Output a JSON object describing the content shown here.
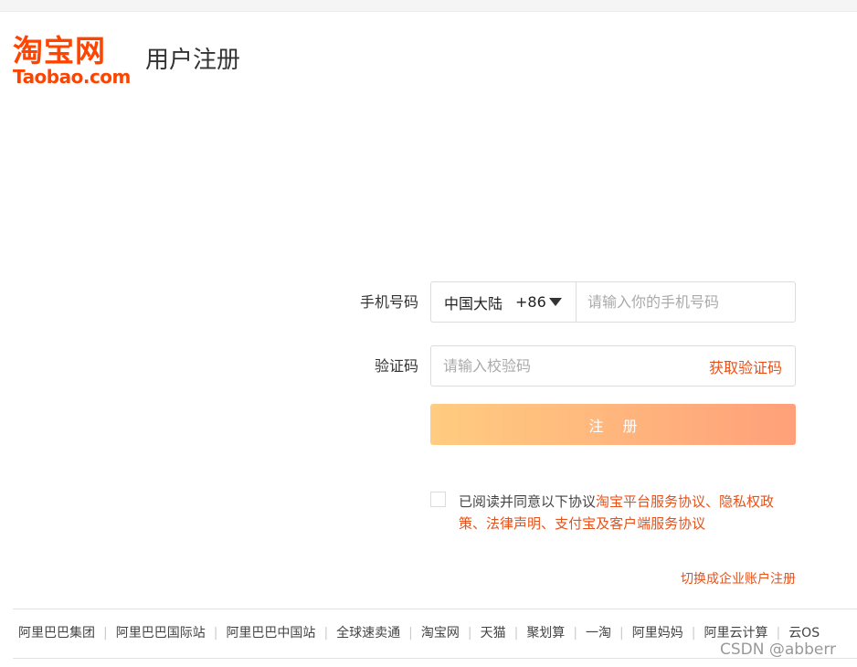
{
  "header": {
    "logo_cn": "淘宝网",
    "logo_en": "Taobao.com",
    "title": "用户注册"
  },
  "form": {
    "phone_label": "手机号码",
    "region_name": "中国大陆",
    "region_code": "+86",
    "phone_placeholder": "请输入你的手机号码",
    "code_label": "验证码",
    "code_placeholder": "请输入校验码",
    "get_code_label": "获取验证码",
    "submit_label": "注 册"
  },
  "agreement": {
    "checked": false,
    "prefix": "已阅读并同意以下协议",
    "links": [
      "淘宝平台服务协议",
      "隐私权政策",
      "法律声明",
      "支付宝及客户端服务协议"
    ],
    "separator": "、"
  },
  "switch_enterprise": "切换成企业账户注册",
  "footer": {
    "links": [
      "阿里巴巴集团",
      "阿里巴巴国际站",
      "阿里巴巴中国站",
      "全球速卖通",
      "淘宝网",
      "天猫",
      "聚划算",
      "一淘",
      "阿里妈妈",
      "阿里云计算",
      "云OS"
    ]
  },
  "watermark": "CSDN @abberr",
  "colors": {
    "brand": "#ff4400",
    "link": "#e6511a",
    "button_gradient_start": "#ffcc80",
    "button_gradient_end": "#ffa07a"
  }
}
